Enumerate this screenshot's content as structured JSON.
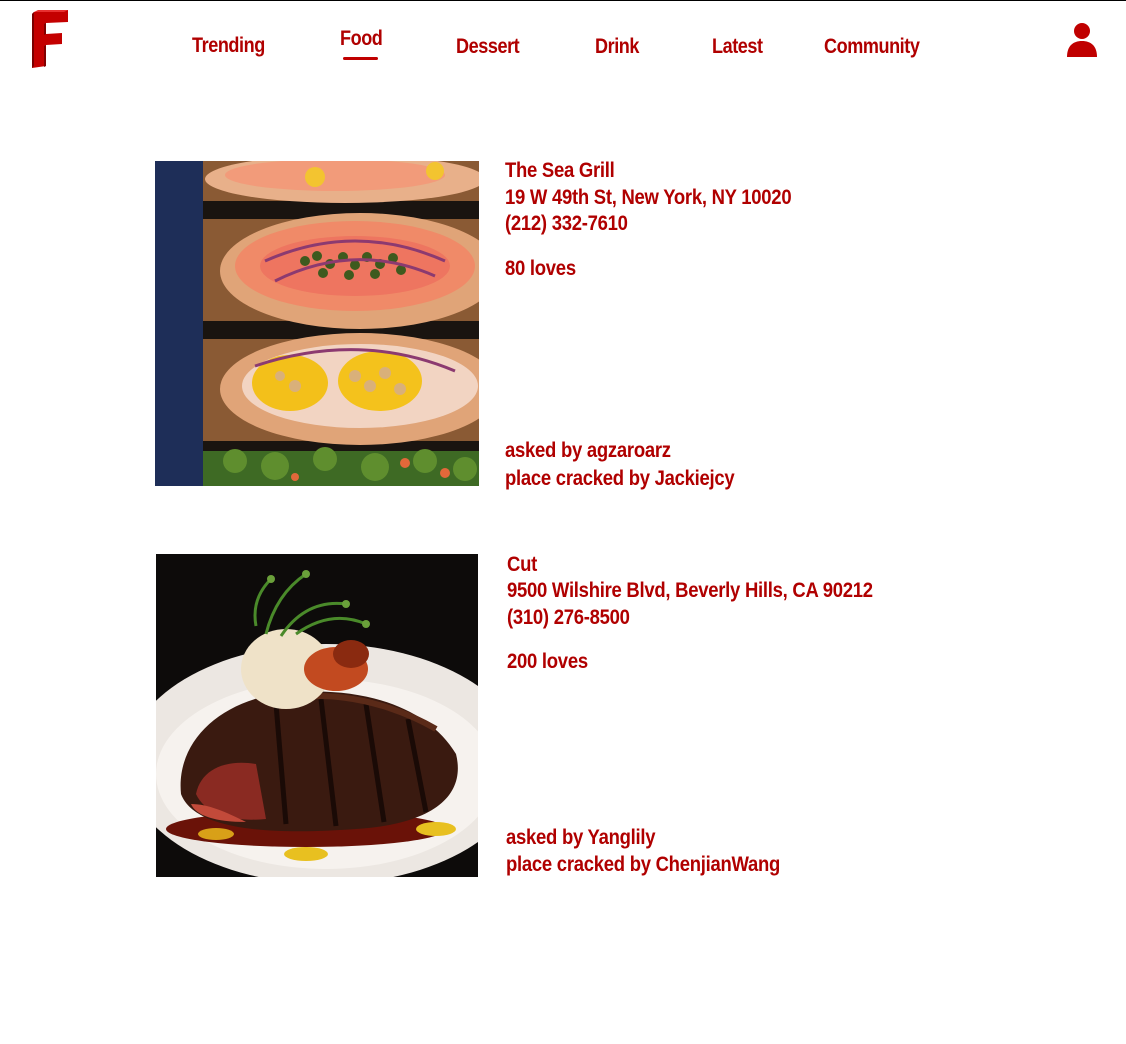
{
  "brand": {
    "accent": "#b00000"
  },
  "nav": {
    "items": [
      {
        "label": "Trending"
      },
      {
        "label": "Food",
        "active": true
      },
      {
        "label": "Dessert"
      },
      {
        "label": "Drink"
      },
      {
        "label": "Latest"
      },
      {
        "label": "Community"
      }
    ]
  },
  "icons": {
    "logo": "f-logo-icon",
    "user": "user-icon"
  },
  "posts": [
    {
      "name": "The Sea Grill",
      "address": "19 W 49th St, New York, NY 10020",
      "phone": "(212) 332-7610",
      "loves": "80 loves",
      "asked_by": "asked by agzaroarz",
      "cracked_by": "place cracked by Jackiejcy"
    },
    {
      "name": "Cut",
      "address": "9500 Wilshire Blvd, Beverly Hills, CA 90212",
      "phone": "(310) 276-8500",
      "loves": "200 loves",
      "asked_by": "asked by Yanglily",
      "cracked_by": "place cracked by ChenjianWang"
    }
  ]
}
